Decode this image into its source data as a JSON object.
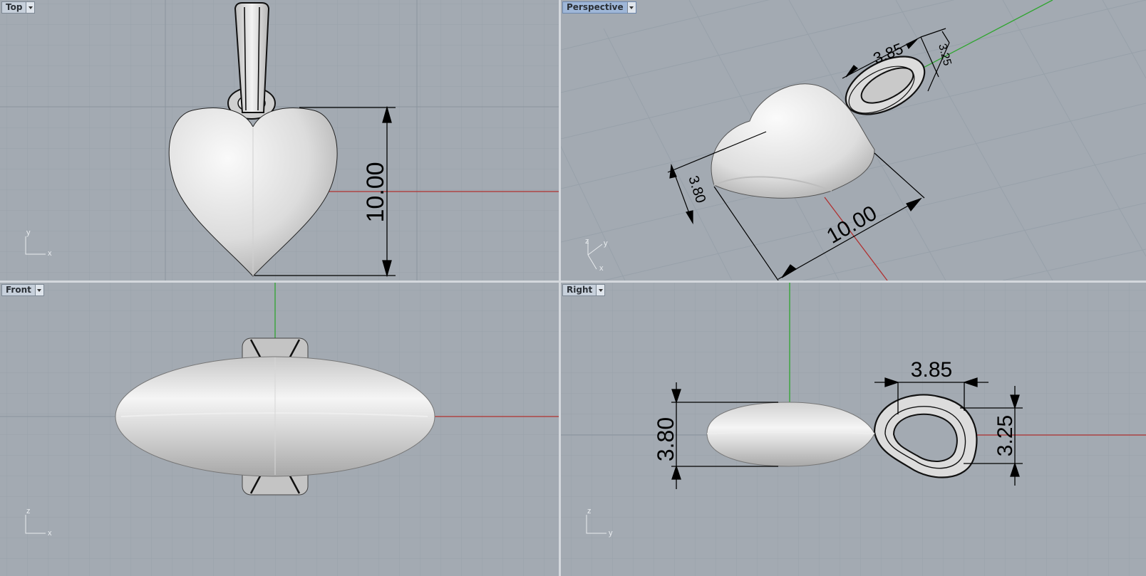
{
  "viewports": {
    "top": {
      "label": "Top"
    },
    "perspective": {
      "label": "Perspective"
    },
    "front": {
      "label": "Front"
    },
    "right": {
      "label": "Right"
    }
  },
  "dimensions": {
    "top": {
      "height": "10.00"
    },
    "perspective": {
      "bail_width": "3.85",
      "bail_depth": "3.25",
      "thickness": "3.80",
      "height": "10.00"
    },
    "right": {
      "bail_width": "3.85",
      "bail_height": "3.25",
      "thickness": "3.80"
    }
  },
  "axes": {
    "top": {
      "a": "y",
      "b": "x"
    },
    "perspective": {
      "a": "z",
      "b": "y",
      "c": "x"
    },
    "front": {
      "a": "z",
      "b": "x"
    },
    "right": {
      "a": "z",
      "b": "y"
    }
  },
  "colors": {
    "background": "#a3aab2",
    "grid_minor": "#97a0a9",
    "grid_major": "#8a939d",
    "x_axis": "#b03030",
    "y_axis": "#2fa52f",
    "active_title": "#9fb7d8",
    "metal": "#e8e8e8"
  }
}
